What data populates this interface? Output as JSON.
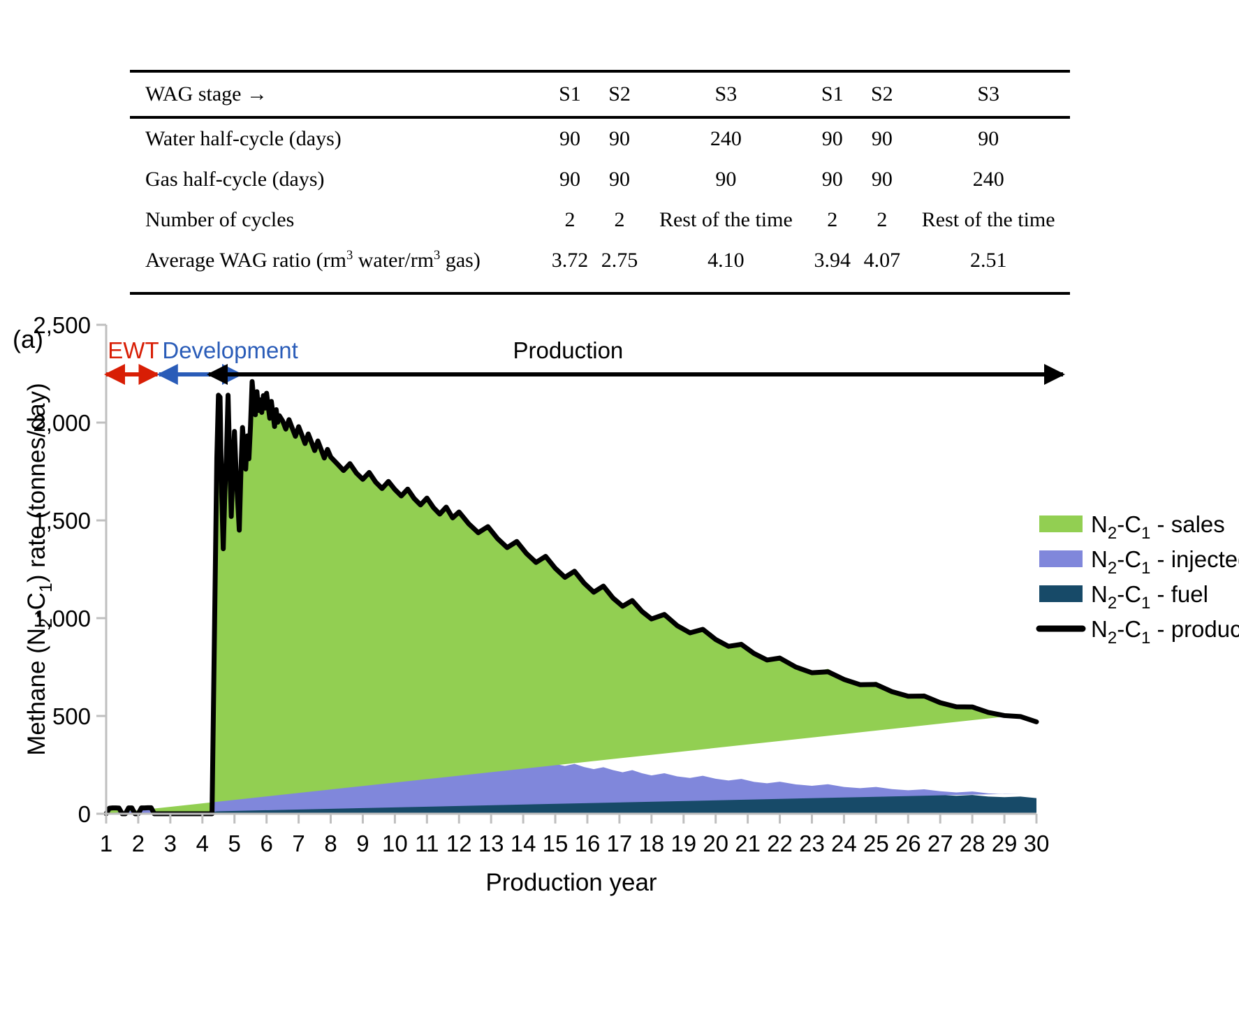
{
  "table": {
    "header": {
      "label": "WAG stage →",
      "stages": [
        "S1",
        "S2",
        "S3",
        "S1",
        "S2",
        "S3"
      ]
    },
    "rows": [
      {
        "label": "Water half-cycle (days)",
        "values": [
          "90",
          "90",
          "240",
          "90",
          "90",
          "90"
        ]
      },
      {
        "label": "Gas half-cycle (days)",
        "values": [
          "90",
          "90",
          "90",
          "90",
          "90",
          "240"
        ]
      },
      {
        "label": "Number of cycles",
        "values": [
          "2",
          "2",
          "Rest of the time",
          "2",
          "2",
          "Rest of the time"
        ]
      },
      {
        "label_prefix": "Average WAG ratio (rm",
        "label_sup1": "3",
        "label_mid": " water/rm",
        "label_sup2": "3",
        "label_suffix": " gas)",
        "values": [
          "3.72",
          "2.75",
          "4.10",
          "3.94",
          "4.07",
          "2.51"
        ]
      }
    ]
  },
  "figure": {
    "panel_label": "(a)",
    "phases": [
      {
        "name": "EWT",
        "color": "#D81E05",
        "label": "EWT"
      },
      {
        "name": "Development",
        "color": "#2A5CB8",
        "label": "Development"
      },
      {
        "name": "Production",
        "color": "#000000",
        "label": "Production"
      }
    ]
  },
  "chart_data": {
    "type": "area",
    "title": "",
    "xlabel": "Production year",
    "ylabel": "Methane (N₂-C₁) rate (tonnes/day)",
    "ylabel_parts": {
      "a": "Methane (N",
      "sub1": "2",
      "b": "-C",
      "sub2": "1",
      "c": ") rate (tonnes/day)"
    },
    "xlim": [
      1,
      30
    ],
    "ylim": [
      0,
      2500
    ],
    "yticks": [
      0,
      500,
      1000,
      1500,
      2000,
      2500
    ],
    "ytick_labels": [
      "0",
      "500",
      "1,000",
      "1,500",
      "2,000",
      "2,500"
    ],
    "xticks": [
      1,
      2,
      3,
      4,
      5,
      6,
      7,
      8,
      9,
      10,
      11,
      12,
      13,
      14,
      15,
      16,
      17,
      18,
      19,
      20,
      21,
      22,
      23,
      24,
      25,
      26,
      27,
      28,
      29,
      30
    ],
    "xtick_labels": [
      "1",
      "2",
      "3",
      "4",
      "5",
      "6",
      "7",
      "8",
      "9",
      "10",
      "11",
      "12",
      "13",
      "14",
      "15",
      "16",
      "17",
      "18",
      "19",
      "20",
      "21",
      "22",
      "23",
      "24",
      "25",
      "26",
      "27",
      "28",
      "29",
      "30"
    ],
    "grid": false,
    "legend_position": "right",
    "colors": {
      "sales": "#92CF52",
      "injected": "#8087DB",
      "fuel": "#174A68",
      "produced": "#000000",
      "axis": "#BFBFBF"
    },
    "legend": [
      {
        "key": "sales",
        "label_a": "N",
        "sub1": "2",
        "label_b": "-C",
        "sub2": "1",
        "label_c": " - sales",
        "marker": "swatch",
        "color": "#92CF52"
      },
      {
        "key": "injected",
        "label_a": "N",
        "sub1": "2",
        "label_b": "-C",
        "sub2": "1",
        "label_c": " - injected",
        "marker": "swatch",
        "color": "#8087DB"
      },
      {
        "key": "fuel",
        "label_a": "N",
        "sub1": "2",
        "label_b": "-C",
        "sub2": "1",
        "label_c": " - fuel",
        "marker": "swatch",
        "color": "#174A68"
      },
      {
        "key": "produced",
        "label_a": "N",
        "sub1": "2",
        "label_b": "-C",
        "sub2": "1",
        "label_c": " - produced",
        "marker": "line",
        "color": "#000000"
      }
    ],
    "x": [
      1.0,
      1.1,
      1.2,
      1.3,
      1.4,
      1.5,
      1.6,
      1.7,
      1.8,
      1.9,
      2.0,
      2.1,
      2.2,
      2.3,
      2.4,
      2.5,
      2.6,
      2.8,
      3.0,
      3.5,
      4.0,
      4.3,
      4.45,
      4.5,
      4.55,
      4.6,
      4.65,
      4.7,
      4.75,
      4.8,
      4.85,
      4.9,
      4.95,
      5.0,
      5.05,
      5.1,
      5.15,
      5.2,
      5.25,
      5.3,
      5.35,
      5.4,
      5.45,
      5.5,
      5.55,
      5.6,
      5.65,
      5.7,
      5.75,
      5.8,
      5.85,
      5.9,
      5.95,
      6.0,
      6.05,
      6.1,
      6.15,
      6.2,
      6.25,
      6.3,
      6.35,
      6.4,
      6.5,
      6.6,
      6.7,
      6.8,
      6.9,
      7.0,
      7.1,
      7.2,
      7.3,
      7.4,
      7.5,
      7.6,
      7.7,
      7.8,
      7.9,
      8.0,
      8.2,
      8.4,
      8.6,
      8.8,
      9.0,
      9.2,
      9.4,
      9.6,
      9.8,
      10.0,
      10.2,
      10.4,
      10.6,
      10.8,
      11.0,
      11.2,
      11.4,
      11.6,
      11.8,
      12.0,
      12.3,
      12.6,
      12.9,
      13.2,
      13.5,
      13.8,
      14.1,
      14.4,
      14.7,
      15.0,
      15.3,
      15.6,
      15.9,
      16.2,
      16.5,
      16.8,
      17.1,
      17.4,
      17.7,
      18.0,
      18.4,
      18.8,
      19.2,
      19.6,
      20.0,
      20.4,
      20.8,
      21.2,
      21.6,
      22.0,
      22.5,
      23.0,
      23.5,
      24.0,
      24.5,
      25.0,
      25.5,
      26.0,
      26.5,
      27.0,
      27.5,
      28.0,
      28.5,
      29.0,
      29.5,
      30.0
    ],
    "series": [
      {
        "name": "N2-C1 - fuel",
        "key": "fuel",
        "values": [
          0,
          20,
          22,
          22,
          21,
          0,
          0,
          22,
          22,
          0,
          0,
          22,
          22,
          23,
          23,
          0,
          0,
          0,
          0,
          0,
          0,
          0,
          120,
          230,
          250,
          200,
          160,
          250,
          270,
          300,
          250,
          200,
          260,
          310,
          260,
          230,
          200,
          250,
          300,
          270,
          240,
          290,
          250,
          300,
          330,
          300,
          280,
          320,
          290,
          310,
          290,
          320,
          300,
          330,
          310,
          290,
          320,
          300,
          280,
          310,
          290,
          300,
          295,
          285,
          300,
          290,
          280,
          295,
          285,
          275,
          290,
          280,
          270,
          285,
          275,
          265,
          275,
          268,
          262,
          255,
          262,
          252,
          248,
          255,
          245,
          240,
          248,
          240,
          235,
          242,
          233,
          228,
          235,
          226,
          220,
          228,
          218,
          225,
          215,
          208,
          215,
          205,
          198,
          205,
          195,
          188,
          195,
          185,
          178,
          185,
          175,
          168,
          175,
          165,
          158,
          165,
          155,
          148,
          155,
          145,
          140,
          148,
          138,
          132,
          138,
          128,
          124,
          130,
          120,
          116,
          122,
          112,
          108,
          112,
          104,
          100,
          104,
          96,
          92,
          96,
          88,
          85,
          88,
          80,
          78,
          80,
          74,
          72
        ]
      },
      {
        "name": "N2-C1 - injected",
        "key": "injected",
        "values": [
          0,
          8,
          8,
          8,
          8,
          0,
          0,
          8,
          8,
          0,
          0,
          8,
          8,
          8,
          8,
          0,
          0,
          0,
          0,
          0,
          0,
          0,
          40,
          60,
          70,
          60,
          55,
          70,
          75,
          80,
          70,
          60,
          75,
          85,
          75,
          70,
          60,
          75,
          85,
          78,
          72,
          82,
          75,
          85,
          130,
          125,
          120,
          128,
          122,
          126,
          122,
          128,
          124,
          130,
          126,
          122,
          128,
          124,
          120,
          126,
          122,
          125,
          124,
          122,
          125,
          122,
          120,
          124,
          122,
          118,
          122,
          120,
          117,
          121,
          118,
          114,
          118,
          116,
          113,
          110,
          113,
          110,
          107,
          110,
          106,
          103,
          106,
          103,
          100,
          103,
          99,
          96,
          99,
          95,
          92,
          95,
          90,
          93,
          88,
          84,
          88,
          82,
          78,
          82,
          76,
          72,
          76,
          70,
          66,
          70,
          64,
          60,
          63,
          58,
          54,
          58,
          52,
          48,
          52,
          46,
          43,
          46,
          41,
          38,
          40,
          35,
          32,
          34,
          30,
          27,
          29,
          25,
          23,
          25,
          22,
          20,
          21,
          19,
          17,
          18,
          16,
          15,
          15
        ]
      },
      {
        "name": "N2-C1 - sales",
        "key": "sales",
        "values": [
          0,
          0,
          0,
          0,
          0,
          0,
          0,
          0,
          0,
          0,
          0,
          0,
          0,
          0,
          0,
          0,
          0,
          0,
          0,
          0,
          0,
          0,
          1660,
          1850,
          1810,
          1380,
          1140,
          1320,
          1480,
          1760,
          1500,
          1260,
          1420,
          1560,
          1410,
          1300,
          1190,
          1420,
          1590,
          1520,
          1450,
          1560,
          1490,
          1600,
          1750,
          1690,
          1640,
          1710,
          1650,
          1680,
          1640,
          1690,
          1650,
          1690,
          1650,
          1610,
          1660,
          1620,
          1580,
          1630,
          1590,
          1610,
          1590,
          1560,
          1590,
          1560,
          1530,
          1560,
          1530,
          1500,
          1530,
          1500,
          1470,
          1500,
          1470,
          1440,
          1470,
          1440,
          1415,
          1390,
          1415,
          1380,
          1355,
          1380,
          1345,
          1320,
          1345,
          1315,
          1290,
          1315,
          1280,
          1255,
          1280,
          1245,
          1220,
          1245,
          1205,
          1225,
          1180,
          1145,
          1165,
          1120,
          1085,
          1105,
          1060,
          1025,
          1045,
          1000,
          965,
          985,
          940,
          905,
          925,
          880,
          848,
          866,
          824,
          796,
          812,
          770,
          742,
          758,
          716,
          690,
          702,
          660,
          635,
          645,
          606,
          582,
          590,
          555,
          533,
          538,
          506,
          486,
          490,
          460,
          442,
          444,
          418,
          402,
          402,
          378,
          366
        ]
      }
    ],
    "produced_line": {
      "name": "N2-C1 - produced",
      "key": "produced",
      "values": [
        0,
        28,
        30,
        30,
        29,
        0,
        0,
        30,
        30,
        0,
        0,
        30,
        30,
        31,
        31,
        0,
        0,
        0,
        0,
        0,
        0,
        0,
        1820,
        2140,
        2130,
        1640,
        1355,
        1640,
        1835,
        2140,
        1820,
        1520,
        1755,
        1955,
        1745,
        1600,
        1450,
        1745,
        1975,
        1868,
        1762,
        1932,
        1815,
        1985,
        2210,
        2115,
        2040,
        2158,
        2062,
        2116,
        2052,
        2138,
        2074,
        2150,
        2086,
        2022,
        2108,
        2044,
        1980,
        2066,
        2002,
        2035,
        2009,
        1967,
        2015,
        1972,
        1930,
        1979,
        1937,
        1893,
        1942,
        1900,
        1857,
        1906,
        1863,
        1819,
        1863,
        1824,
        1790,
        1755,
        1790,
        1742,
        1710,
        1745,
        1696,
        1663,
        1699,
        1658,
        1625,
        1660,
        1612,
        1579,
        1614,
        1566,
        1532,
        1568,
        1513,
        1543,
        1483,
        1437,
        1468,
        1407,
        1361,
        1392,
        1331,
        1285,
        1316,
        1255,
        1209,
        1240,
        1179,
        1133,
        1164,
        1103,
        1061,
        1090,
        1035,
        996,
        1019,
        962,
        925,
        943,
        891,
        856,
        866,
        819,
        786,
        796,
        750,
        721,
        726,
        687,
        660,
        661,
        624,
        601,
        602,
        568,
        547,
        546,
        518,
        502,
        497,
        470,
        453
      ]
    },
    "phase_spans": [
      {
        "name": "EWT",
        "x_start": 1.0,
        "x_end": 2.6
      },
      {
        "name": "Development",
        "x_start": 2.65,
        "x_end": 5.2
      },
      {
        "name": "Production",
        "x_start": 4.2,
        "x_end": 30.0
      }
    ]
  }
}
